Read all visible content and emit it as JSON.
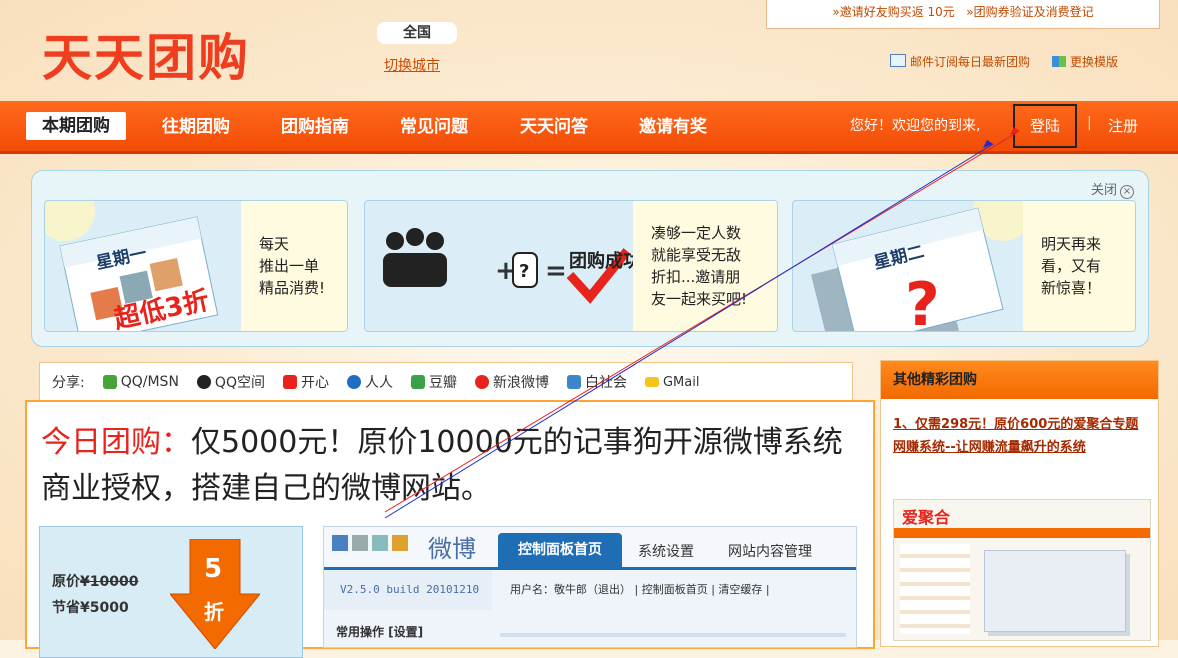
{
  "brand": {
    "logo": "天天团购"
  },
  "city": {
    "current": "全国",
    "switch": "切换城市"
  },
  "top_links": {
    "invite": "»邀请好友购买返 10元",
    "verify": "»团购券验证及消费登记"
  },
  "sub_links": {
    "email": "邮件订阅每日最新团购",
    "template": "更换模版"
  },
  "nav": {
    "items": [
      "本期团购",
      "往期团购",
      "团购指南",
      "常见问题",
      "天天问答",
      "邀请有奖"
    ],
    "welcome": "您好！欢迎您的到来,",
    "login": "登陆",
    "sep": "|",
    "register": "注册"
  },
  "promo": {
    "close": "关闭",
    "card1": {
      "day": "星期一",
      "stamp": "超低3折",
      "text": [
        "每天",
        "推出一单",
        "精品消费!"
      ]
    },
    "card2": {
      "badge": "团购成功",
      "text": [
        "凑够一定人数",
        "就能享受无敌",
        "折扣...邀请朋",
        "友一起来买吧!"
      ]
    },
    "card3": {
      "day": "星期二",
      "text": [
        "明天再来",
        "看，又有",
        "新惊喜！"
      ]
    }
  },
  "share": {
    "label": "分享:",
    "items": [
      "QQ/MSN",
      "QQ空间",
      "开心",
      "人人",
      "豆瓣",
      "新浪微博",
      "白社会",
      "GMail"
    ]
  },
  "deal": {
    "prefix": "今日团购",
    "colon": "：",
    "title": "仅5000元！原价10000元的记事狗开源微博系统商业授权，搭建自己的微博网站。",
    "original_label": "原价",
    "original_price": "¥10000",
    "save_label": "节省",
    "save_price": "¥5000",
    "discount_num": "5",
    "discount_unit": "折"
  },
  "screenshot": {
    "brand": "微博",
    "tab_active": "控制面板首页",
    "tab2": "系统设置",
    "tab3": "网站内容管理",
    "version": "V2.5.0 build 20101210",
    "user_line": "用户名：敬牛郎（退出） | 控制面板首页 | 清空缓存 |",
    "ops": "常用操作 [设置]"
  },
  "sidebar": {
    "title": "其他精彩团购",
    "link": "1、仅需298元！原价600元的爱聚合专题网赚系统--让网赚流量飙升的系统",
    "img_brand": "爱聚合"
  },
  "colors": {
    "nav": "#f24c05",
    "accent": "#ef3e1f",
    "deal_border": "#ffa437"
  }
}
